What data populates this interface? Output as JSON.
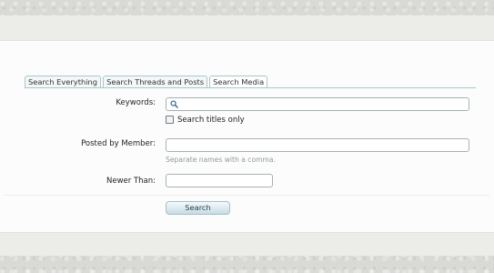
{
  "tabs": [
    {
      "label": "Search Everything",
      "active": false
    },
    {
      "label": "Search Threads and Posts",
      "active": false
    },
    {
      "label": "Search Media",
      "active": true
    }
  ],
  "form": {
    "keywords_label": "Keywords:",
    "keywords_value": "",
    "titles_only_label": "Search titles only",
    "titles_only_checked": false,
    "member_label": "Posted by Member:",
    "member_value": "",
    "member_hint": "Separate names with a comma.",
    "newer_label": "Newer Than:",
    "newer_value": "",
    "submit_label": "Search"
  },
  "icons": {
    "search_field": "search-icon"
  },
  "colors": {
    "tab_border": "#a9c7cc",
    "button_text": "#1f3b4d",
    "hint_text": "#959a9b"
  }
}
